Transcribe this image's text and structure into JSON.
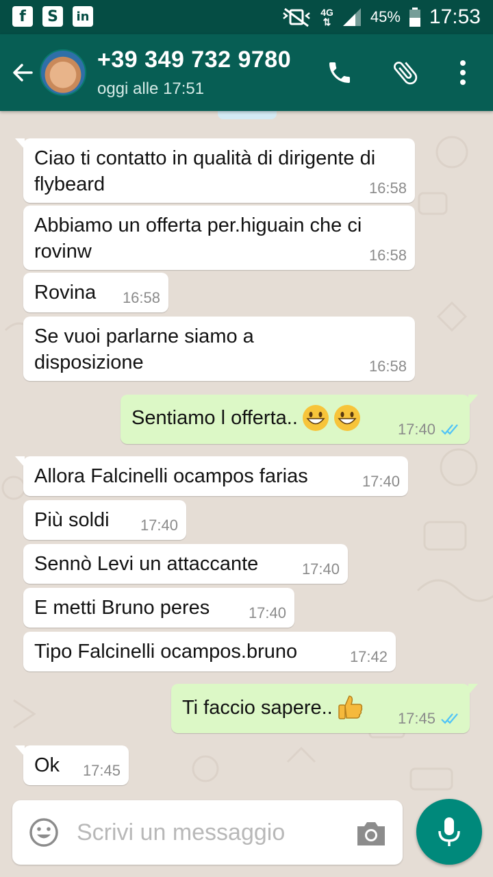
{
  "status_bar": {
    "apps": [
      {
        "icon": "facebook-icon",
        "glyph": "f"
      },
      {
        "icon": "skype-icon",
        "glyph": "S"
      },
      {
        "icon": "linkedin-icon",
        "glyph": "in"
      }
    ],
    "network": "4G",
    "battery": "45%",
    "time": "17:53"
  },
  "header": {
    "contact": "+39 349 732 9780",
    "last_seen": "oggi alle 17:51"
  },
  "messages": [
    {
      "dir": "in",
      "text": "Ciao ti contatto in qualità di dirigente di flybeard",
      "time": "16:58"
    },
    {
      "dir": "in",
      "text": "Abbiamo un offerta per.higuain che ci rovinw",
      "time": "16:58"
    },
    {
      "dir": "in",
      "text": "Rovina",
      "time": "16:58"
    },
    {
      "dir": "in",
      "text": "Se vuoi parlarne siamo a disposizione",
      "time": "16:58"
    },
    {
      "dir": "out",
      "text": "Sentiamo l offerta..",
      "emoji": [
        "grinning-face-icon",
        "grinning-face-icon"
      ],
      "time": "17:40",
      "status": "read"
    },
    {
      "dir": "in",
      "text": "Allora Falcinelli ocampos farias",
      "time": "17:40"
    },
    {
      "dir": "in",
      "text": "Più soldi",
      "time": "17:40"
    },
    {
      "dir": "in",
      "text": "Sennò Levi un attaccante",
      "time": "17:40"
    },
    {
      "dir": "in",
      "text": "E metti Bruno peres",
      "time": "17:40"
    },
    {
      "dir": "in",
      "text": "Tipo Falcinelli ocampos.bruno",
      "time": "17:42"
    },
    {
      "dir": "out",
      "text": "Ti faccio sapere..",
      "emoji": [
        "thumbs-up-icon"
      ],
      "time": "17:45",
      "status": "read"
    },
    {
      "dir": "in",
      "text": "Ok",
      "time": "17:45"
    }
  ],
  "composer": {
    "placeholder": "Scrivi un messaggio"
  },
  "colors": {
    "header": "#075e54",
    "status_bar": "#054d44",
    "outgoing_bubble": "#dcf8c6",
    "incoming_bubble": "#ffffff",
    "read_ticks": "#4fc3f7",
    "mic_button": "#00897b"
  }
}
